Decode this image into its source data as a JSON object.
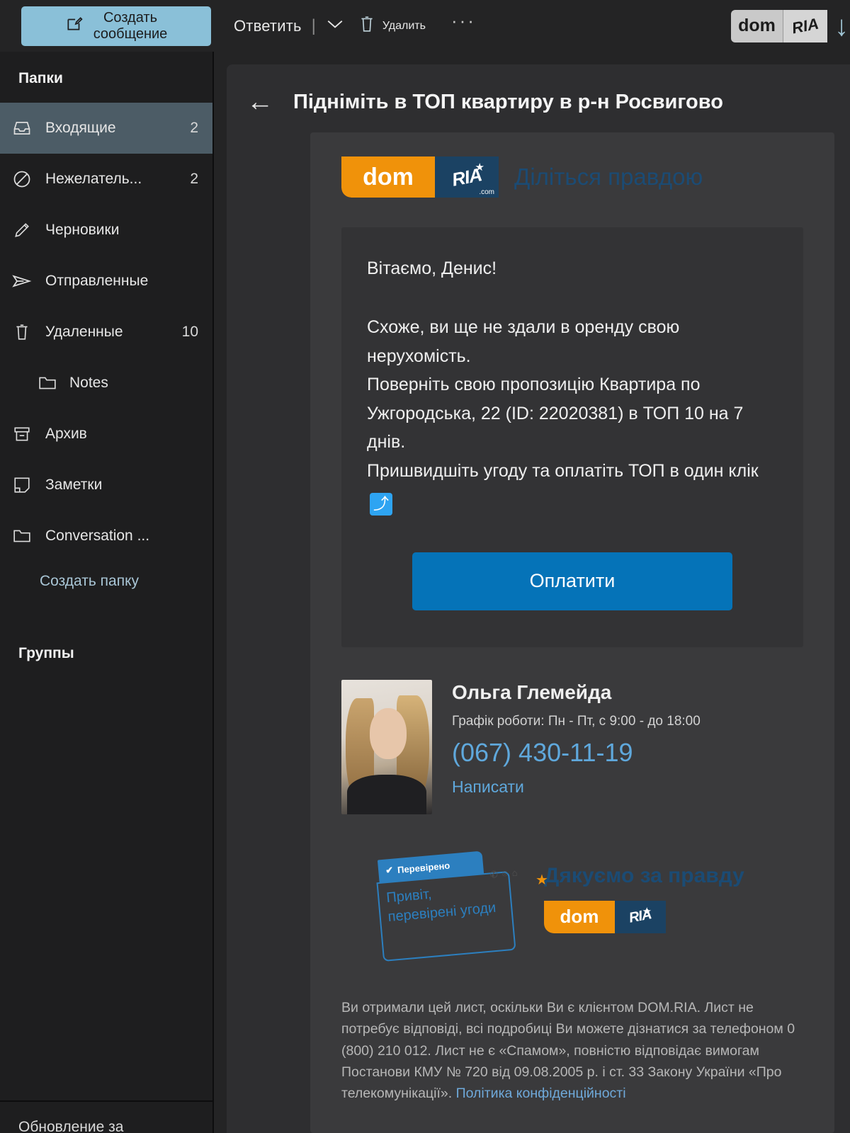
{
  "toolbar": {
    "compose_label_line1": "Создать",
    "compose_label_line2": "сообщение",
    "reply_label": "Ответить",
    "delete_label": "Удалить",
    "more_label": "···",
    "sender_logo_left": "dom",
    "sender_logo_right": "RIA",
    "download_arrow": "↓"
  },
  "sidebar": {
    "folders_title": "Папки",
    "groups_title": "Группы",
    "create_folder_label": "Создать папку",
    "bottom_partial_text": "Обновление за",
    "items": [
      {
        "label": "Входящие",
        "count": "2",
        "icon": "inbox-icon",
        "selected": true,
        "sub": false
      },
      {
        "label": "Нежелатель...",
        "count": "2",
        "icon": "block-icon",
        "selected": false,
        "sub": false
      },
      {
        "label": "Черновики",
        "count": "",
        "icon": "pencil-icon",
        "selected": false,
        "sub": false
      },
      {
        "label": "Отправленные",
        "count": "",
        "icon": "send-icon",
        "selected": false,
        "sub": false
      },
      {
        "label": "Удаленные",
        "count": "10",
        "icon": "trash-icon",
        "selected": false,
        "sub": false
      },
      {
        "label": "Notes",
        "count": "",
        "icon": "folder-icon",
        "selected": false,
        "sub": true
      },
      {
        "label": "Архив",
        "count": "",
        "icon": "archive-icon",
        "selected": false,
        "sub": false
      },
      {
        "label": "Заметки",
        "count": "",
        "icon": "note-icon",
        "selected": false,
        "sub": false
      },
      {
        "label": "Conversation ...",
        "count": "",
        "icon": "folder-icon",
        "selected": false,
        "sub": false
      }
    ]
  },
  "message": {
    "subject": "Підніміть в ТОП квартиру в р-н Росвигово",
    "back_label": "←",
    "brand": {
      "logo_left": "dom",
      "logo_right": "RIA",
      "logo_suffix": ".com",
      "tagline": "Діліться правдою"
    },
    "greeting": "Вітаємо, Денис!",
    "paragraphs": [
      "Схоже, ви ще не здали в оренду свою нерухомість.",
      "Поверніть свою пропозицію Квартира по Ужгородська, 22 (ID: 22020381) в ТОП 10 на 7 днів.",
      "Пришвидшіть угоду та оплатіть ТОП в один клік"
    ],
    "emoji": "⤴",
    "pay_button": "Оплатити",
    "contact": {
      "name": "Ольга Глемейда",
      "hours": "Графік роботи: Пн - Пт, с 9:00 - до 18:00",
      "phone": "(067) 430-11-19",
      "write_link": "Написати"
    },
    "verified": {
      "tab_label": "Перевірено",
      "box_line1": "Привіт,",
      "box_line2": "перевірені угоди",
      "thanks_title": "Дякуємо за правду",
      "logo_left": "dom",
      "logo_right": "RIA"
    },
    "disclaimer_text": "Ви отримали цей лист, оскільки Ви є клієнтом DOM.RIA. Лист не потребує відповіді, всі подробиці Ви можете дізнатися за телефоном 0 (800) 210 012. Лист не є «Спамом», повністю відповідає вимогам Постанови КМУ № 720 від 09.08.2005 р. і ст. 33 Закону України «Про телекомунікації». ",
    "privacy_link": "Політика конфіденційності"
  },
  "colors": {
    "compose_bg": "#8AC0D8",
    "selected_folder_bg": "#4C5C66",
    "brand_orange": "#F0920A",
    "brand_navy": "#1B4263",
    "pay_button_bg": "#0573B8",
    "link_blue": "#5FA8DC"
  }
}
